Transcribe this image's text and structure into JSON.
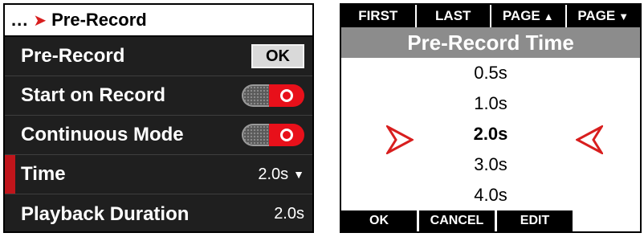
{
  "left": {
    "header": {
      "dots": "...",
      "title": "Pre-Record"
    },
    "rows": [
      {
        "label": "Pre-Record",
        "control": "button",
        "button_label": "OK"
      },
      {
        "label": "Start on Record",
        "control": "toggle",
        "state": "on"
      },
      {
        "label": "Continuous Mode",
        "control": "toggle",
        "state": "on"
      },
      {
        "label": "Time",
        "control": "dropdown",
        "value": "2.0s",
        "selected": true
      },
      {
        "label": "Playback Duration",
        "control": "value",
        "value": "2.0s"
      }
    ]
  },
  "right": {
    "nav": {
      "first": "FIRST",
      "last": "LAST",
      "page_up": "PAGE",
      "page_down": "PAGE"
    },
    "title": "Pre-Record Time",
    "options": [
      "0.5s",
      "1.0s",
      "2.0s",
      "3.0s",
      "4.0s"
    ],
    "selected_option": "2.0s",
    "bottom": {
      "ok": "OK",
      "cancel": "CANCEL",
      "edit": "EDIT"
    }
  },
  "colors": {
    "accent_red": "#e8101a",
    "selection_bar": "#c0151b",
    "panel_dark": "#1f1f1f",
    "title_gray": "#8c8c8c"
  },
  "icons": {
    "header_arrow": "chevron-right-icon",
    "dropdown": "caret-down-icon",
    "page_up": "triangle-up-icon",
    "page_down": "triangle-down-icon",
    "selector_left": "selector-arrow-right-icon",
    "selector_right": "selector-arrow-left-icon"
  }
}
